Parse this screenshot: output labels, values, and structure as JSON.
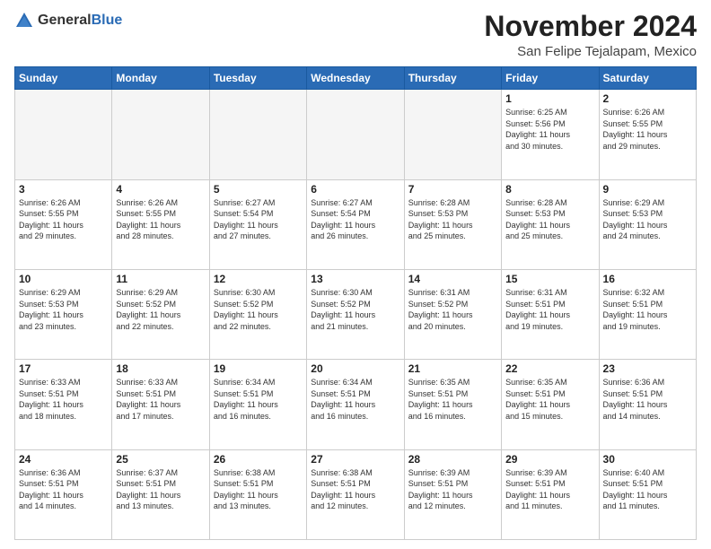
{
  "logo": {
    "general": "General",
    "blue": "Blue"
  },
  "header": {
    "month": "November 2024",
    "location": "San Felipe Tejalapam, Mexico"
  },
  "weekdays": [
    "Sunday",
    "Monday",
    "Tuesday",
    "Wednesday",
    "Thursday",
    "Friday",
    "Saturday"
  ],
  "weeks": [
    [
      {
        "day": "",
        "info": ""
      },
      {
        "day": "",
        "info": ""
      },
      {
        "day": "",
        "info": ""
      },
      {
        "day": "",
        "info": ""
      },
      {
        "day": "",
        "info": ""
      },
      {
        "day": "1",
        "info": "Sunrise: 6:25 AM\nSunset: 5:56 PM\nDaylight: 11 hours\nand 30 minutes."
      },
      {
        "day": "2",
        "info": "Sunrise: 6:26 AM\nSunset: 5:55 PM\nDaylight: 11 hours\nand 29 minutes."
      }
    ],
    [
      {
        "day": "3",
        "info": "Sunrise: 6:26 AM\nSunset: 5:55 PM\nDaylight: 11 hours\nand 29 minutes."
      },
      {
        "day": "4",
        "info": "Sunrise: 6:26 AM\nSunset: 5:55 PM\nDaylight: 11 hours\nand 28 minutes."
      },
      {
        "day": "5",
        "info": "Sunrise: 6:27 AM\nSunset: 5:54 PM\nDaylight: 11 hours\nand 27 minutes."
      },
      {
        "day": "6",
        "info": "Sunrise: 6:27 AM\nSunset: 5:54 PM\nDaylight: 11 hours\nand 26 minutes."
      },
      {
        "day": "7",
        "info": "Sunrise: 6:28 AM\nSunset: 5:53 PM\nDaylight: 11 hours\nand 25 minutes."
      },
      {
        "day": "8",
        "info": "Sunrise: 6:28 AM\nSunset: 5:53 PM\nDaylight: 11 hours\nand 25 minutes."
      },
      {
        "day": "9",
        "info": "Sunrise: 6:29 AM\nSunset: 5:53 PM\nDaylight: 11 hours\nand 24 minutes."
      }
    ],
    [
      {
        "day": "10",
        "info": "Sunrise: 6:29 AM\nSunset: 5:53 PM\nDaylight: 11 hours\nand 23 minutes."
      },
      {
        "day": "11",
        "info": "Sunrise: 6:29 AM\nSunset: 5:52 PM\nDaylight: 11 hours\nand 22 minutes."
      },
      {
        "day": "12",
        "info": "Sunrise: 6:30 AM\nSunset: 5:52 PM\nDaylight: 11 hours\nand 22 minutes."
      },
      {
        "day": "13",
        "info": "Sunrise: 6:30 AM\nSunset: 5:52 PM\nDaylight: 11 hours\nand 21 minutes."
      },
      {
        "day": "14",
        "info": "Sunrise: 6:31 AM\nSunset: 5:52 PM\nDaylight: 11 hours\nand 20 minutes."
      },
      {
        "day": "15",
        "info": "Sunrise: 6:31 AM\nSunset: 5:51 PM\nDaylight: 11 hours\nand 19 minutes."
      },
      {
        "day": "16",
        "info": "Sunrise: 6:32 AM\nSunset: 5:51 PM\nDaylight: 11 hours\nand 19 minutes."
      }
    ],
    [
      {
        "day": "17",
        "info": "Sunrise: 6:33 AM\nSunset: 5:51 PM\nDaylight: 11 hours\nand 18 minutes."
      },
      {
        "day": "18",
        "info": "Sunrise: 6:33 AM\nSunset: 5:51 PM\nDaylight: 11 hours\nand 17 minutes."
      },
      {
        "day": "19",
        "info": "Sunrise: 6:34 AM\nSunset: 5:51 PM\nDaylight: 11 hours\nand 16 minutes."
      },
      {
        "day": "20",
        "info": "Sunrise: 6:34 AM\nSunset: 5:51 PM\nDaylight: 11 hours\nand 16 minutes."
      },
      {
        "day": "21",
        "info": "Sunrise: 6:35 AM\nSunset: 5:51 PM\nDaylight: 11 hours\nand 16 minutes."
      },
      {
        "day": "22",
        "info": "Sunrise: 6:35 AM\nSunset: 5:51 PM\nDaylight: 11 hours\nand 15 minutes."
      },
      {
        "day": "23",
        "info": "Sunrise: 6:36 AM\nSunset: 5:51 PM\nDaylight: 11 hours\nand 14 minutes."
      }
    ],
    [
      {
        "day": "24",
        "info": "Sunrise: 6:36 AM\nSunset: 5:51 PM\nDaylight: 11 hours\nand 14 minutes."
      },
      {
        "day": "25",
        "info": "Sunrise: 6:37 AM\nSunset: 5:51 PM\nDaylight: 11 hours\nand 13 minutes."
      },
      {
        "day": "26",
        "info": "Sunrise: 6:38 AM\nSunset: 5:51 PM\nDaylight: 11 hours\nand 13 minutes."
      },
      {
        "day": "27",
        "info": "Sunrise: 6:38 AM\nSunset: 5:51 PM\nDaylight: 11 hours\nand 12 minutes."
      },
      {
        "day": "28",
        "info": "Sunrise: 6:39 AM\nSunset: 5:51 PM\nDaylight: 11 hours\nand 12 minutes."
      },
      {
        "day": "29",
        "info": "Sunrise: 6:39 AM\nSunset: 5:51 PM\nDaylight: 11 hours\nand 11 minutes."
      },
      {
        "day": "30",
        "info": "Sunrise: 6:40 AM\nSunset: 5:51 PM\nDaylight: 11 hours\nand 11 minutes."
      }
    ]
  ]
}
